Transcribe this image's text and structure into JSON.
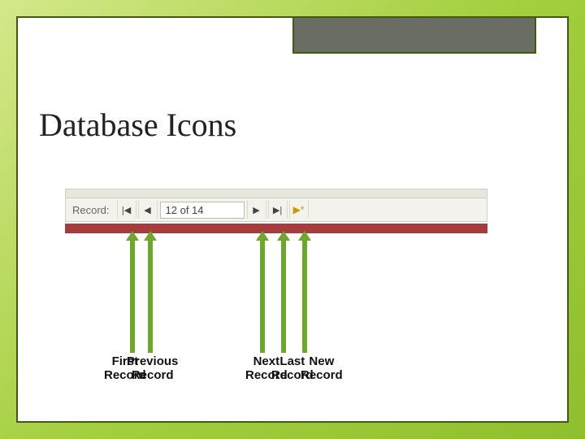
{
  "title": "Database Icons",
  "navigator": {
    "label": "Record:",
    "count_text": "12 of 14",
    "first_icon": "|◀",
    "prev_icon": "◀",
    "next_icon": "▶",
    "last_icon": "▶|",
    "new_icon": "▶*"
  },
  "callouts": {
    "first": "First\nRecord",
    "previous": "Previous\nRecord",
    "next": "Next\nRecord",
    "last": "Last\nRecord",
    "new": "New\nRecord"
  }
}
